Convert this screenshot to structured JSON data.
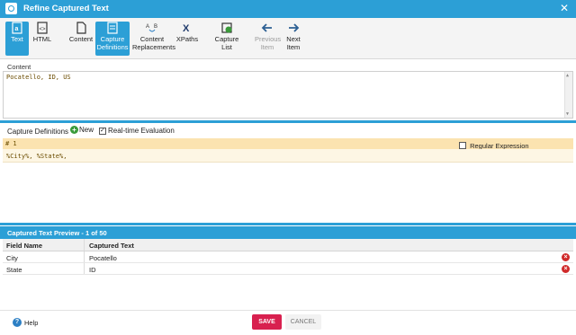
{
  "window": {
    "title": "Refine Captured Text",
    "close_glyph": "✕"
  },
  "toolbar": {
    "text_label": "Text",
    "html_label": "HTML",
    "content_label": "Content",
    "capture_definitions_label_1": "Capture",
    "capture_definitions_label_2": "Definitions",
    "content_replacements_label_1": "Content",
    "content_replacements_label_2": "Replacements",
    "xpaths_label": "XPaths",
    "capture_list_label_1": "Capture",
    "capture_list_label_2": "List",
    "previous_item_label_1": "Previous",
    "previous_item_label_2": "Item",
    "next_item_label_1": "Next",
    "next_item_label_2": "Item"
  },
  "content": {
    "label": "Content",
    "text": "Pocatello, ID, US"
  },
  "capture_definitions": {
    "label": "Capture Definitions",
    "new_label": "New",
    "realtime_label": "Real-time Evaluation",
    "realtime_checked": true,
    "header_text": "# 1",
    "regex_label": "Regular Expression",
    "regex_checked": false,
    "definition_text": "%City%, %State%,"
  },
  "preview": {
    "title": "Captured Text Preview - 1 of 50",
    "columns": [
      "Field Name",
      "Captured Text"
    ],
    "rows": [
      {
        "field": "City",
        "value": "Pocatello"
      },
      {
        "field": "State",
        "value": "ID"
      }
    ]
  },
  "footer": {
    "help_label": "Help",
    "save_label": "SAVE",
    "cancel_label": "CANCEL"
  },
  "colors": {
    "accent": "#2c9fd6",
    "save": "#d8204f",
    "definition_header": "#fbe3b0",
    "delete": "#d02a2a"
  }
}
